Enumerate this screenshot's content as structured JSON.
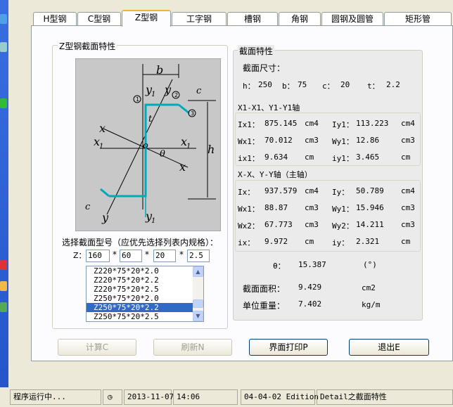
{
  "tabs": [
    "H型钢",
    "C型钢",
    "Z型钢",
    "工字钢",
    "槽钢",
    "角钢",
    "圆钢及圆管",
    "矩形管"
  ],
  "left_group": {
    "title": "Z型钢截面特性",
    "diagram": {
      "b": "b",
      "h": "h",
      "t": "t",
      "c": "c",
      "y1_top": "y",
      "y1_top_sub": "1",
      "y_top": "y",
      "x_left": "x",
      "x1_left": "x",
      "x1_left_sub": "1",
      "o": "o",
      "x1_right": "x",
      "x1_right_sub": "1",
      "theta": "θ",
      "x_right": "x",
      "y_bottom": "y",
      "y1_bottom": "y",
      "y1_bottom_sub": "1",
      "c_bottom": "c",
      "m1": "1",
      "m2": "2",
      "m3": "3"
    },
    "select_label": "选择截面型号（应优先选择列表内规格）：",
    "z_label": "Z：",
    "z_values": [
      "160",
      "60",
      "20",
      "2.5"
    ],
    "star": "*",
    "list_items": [
      "Z220*75*20*2.0",
      "Z220*75*20*2.2",
      "Z220*75*20*2.5",
      "Z250*75*20*2.0",
      "Z250*75*20*2.2",
      "Z250*75*20*2.5"
    ],
    "selected_index": 4
  },
  "right_group": {
    "title": "截面特性",
    "size_label": "截面尺寸：",
    "dims": [
      {
        "k": "h：",
        "v": "250"
      },
      {
        "k": "b：",
        "v": "75"
      },
      {
        "k": "c：",
        "v": "20"
      },
      {
        "k": "t：",
        "v": "2.2"
      }
    ],
    "axis1_label": "X1-X1、Y1-Y1轴",
    "axis1_rows": [
      {
        "l": "Ix1：",
        "lv": "875.145",
        "lu": "cm4",
        "r": "Iy1：",
        "rv": "113.223",
        "ru": "cm4"
      },
      {
        "l": "Wx1：",
        "lv": "70.012",
        "lu": "cm3",
        "r": "Wy1：",
        "rv": "12.86",
        "ru": "cm3"
      },
      {
        "l": "ix1：",
        "lv": "9.634",
        "lu": "cm",
        "r": "iy1：",
        "rv": "3.465",
        "ru": "cm"
      }
    ],
    "axis2_label": "X-X、Y-Y轴（主轴）",
    "axis2_rows": [
      {
        "l": "Ix：",
        "lv": "937.579",
        "lu": "cm4",
        "r": "Iy：",
        "rv": "50.789",
        "ru": "cm4"
      },
      {
        "l": "Wx1：",
        "lv": "88.87",
        "lu": "cm3",
        "r": "Wy1：",
        "rv": "15.946",
        "ru": "cm3"
      },
      {
        "l": "Wx2：",
        "lv": "67.773",
        "lu": "cm3",
        "r": "Wy2：",
        "rv": "14.211",
        "ru": "cm3"
      },
      {
        "l": "ix：",
        "lv": "9.972",
        "lu": "cm",
        "r": "iy：",
        "rv": "2.321",
        "ru": "cm"
      }
    ],
    "theta": {
      "l": "θ：",
      "v": "15.387",
      "u": "(°)"
    },
    "area": {
      "l": "截面面积：",
      "v": "9.429",
      "u": "cm2"
    },
    "weight": {
      "l": "单位重量：",
      "v": "7.402",
      "u": "kg/m"
    }
  },
  "buttons": {
    "calc": "计算C",
    "refresh": "刷新N",
    "print": "界面打印P",
    "exit": "退出E"
  },
  "status": {
    "running": "程序运行中...",
    "date": "2013-11-07",
    "time": "14:06",
    "edition": "04-04-02 Edition",
    "detail": "Detail之截面特性"
  }
}
